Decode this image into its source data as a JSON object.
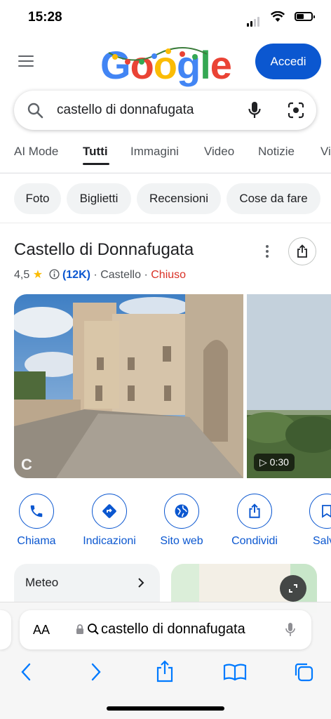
{
  "status": {
    "time": "15:28"
  },
  "header": {
    "logo_letters": [
      "G",
      "o",
      "o",
      "g",
      "l",
      "e"
    ],
    "signin_label": "Accedi"
  },
  "search": {
    "query": "castello di donnafugata"
  },
  "tabs": [
    {
      "label": "AI Mode"
    },
    {
      "label": "Tutti",
      "active": true
    },
    {
      "label": "Immagini"
    },
    {
      "label": "Video"
    },
    {
      "label": "Notizie"
    },
    {
      "label": "Vi"
    }
  ],
  "chips": [
    {
      "label": "Foto"
    },
    {
      "label": "Biglietti"
    },
    {
      "label": "Recensioni"
    },
    {
      "label": "Cose da fare"
    }
  ],
  "place": {
    "title": "Castello di Donnafugata",
    "rating": "4,5",
    "reviews": "(12K)",
    "category": "Castello",
    "status": "Chiuso",
    "video_duration": "0:30"
  },
  "actions": [
    {
      "label": "Chiama",
      "icon": "phone-icon"
    },
    {
      "label": "Indicazioni",
      "icon": "directions-icon"
    },
    {
      "label": "Sito web",
      "icon": "globe-icon"
    },
    {
      "label": "Condividi",
      "icon": "share-icon"
    },
    {
      "label": "Salva",
      "icon": "bookmark-icon"
    }
  ],
  "cards": {
    "weather_label": "Meteo"
  },
  "browser": {
    "aa_label": "AA",
    "url_text": "castello di donnafugata"
  },
  "colors": {
    "accent": "#0b57d0",
    "closed": "#d93025",
    "star": "#fbbc04"
  }
}
